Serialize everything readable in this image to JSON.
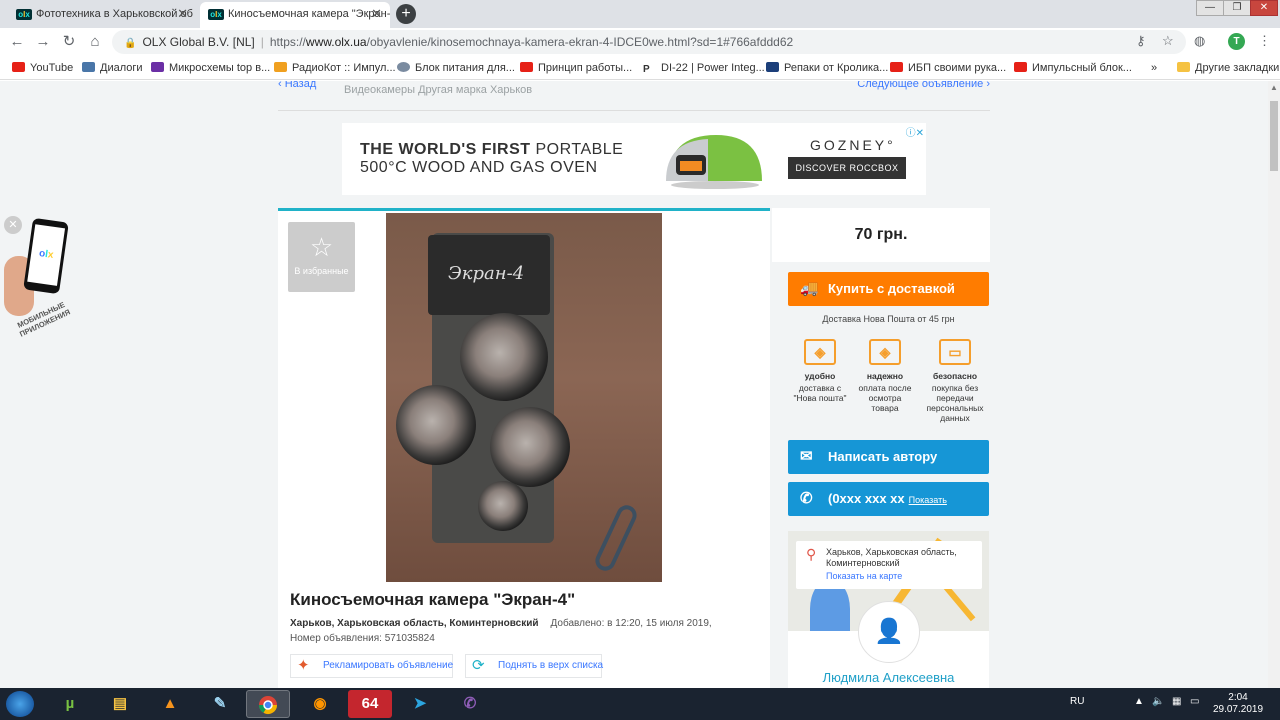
{
  "browser": {
    "tabs": [
      {
        "title": "Фототехника в Харьковской об",
        "close": "✕"
      },
      {
        "title": "Киносъемочная камера \"Экран-",
        "close": "✕"
      }
    ],
    "new_tab": "+",
    "window_controls": {
      "minimize": "—",
      "maximize": "❐",
      "close": "✕"
    },
    "address": {
      "org": "OLX Global B.V. [NL]",
      "url_prefix": "https://",
      "url_host": "www.olx.ua",
      "url_path": "/obyavlenie/kinosemochnaya-kamera-ekran-4-IDCE0we.html?sd=1#766afddd62"
    },
    "profile_initial": "T",
    "bookmarks": [
      {
        "label": "YouTube",
        "icon": "youtube-icon"
      },
      {
        "label": "Диалоги",
        "icon": "vk-icon"
      },
      {
        "label": "Микросхемы top в...",
        "icon": "bookmark-icon"
      },
      {
        "label": "РадиоКот :: Импул...",
        "icon": "radiokot-icon"
      },
      {
        "label": "Блок питания для...",
        "icon": "globe-icon"
      },
      {
        "label": "Принцип работы...",
        "icon": "youtube-icon"
      },
      {
        "label": "DI-22 | Power Integ...",
        "icon": "p-icon"
      },
      {
        "label": "Репаки от Кролика...",
        "icon": "re-icon"
      },
      {
        "label": "ИБП своими рука...",
        "icon": "youtube-icon"
      },
      {
        "label": "Импульсный блок...",
        "icon": "youtube-icon"
      }
    ],
    "bookmarks_overflow": "»",
    "other_bookmarks": "Другие закладки"
  },
  "breadcrumb": {
    "back": "Назад",
    "path": "Видеокамеры Другая марка Харьков",
    "next": "Следующее объявление"
  },
  "ad": {
    "line1_bold": "THE WORLD'S FIRST",
    "line1_light": "PORTABLE",
    "line2": "500°C WOOD AND GAS OVEN",
    "brand": "GOZNEY°",
    "cta": "DISCOVER ROCCBOX"
  },
  "listing": {
    "favorite_label": "В избранные",
    "camera_plate": "Экран-4",
    "title": "Киносъемочная камера \"Экран-4\"",
    "location": "Харьков, Харьковская область, Коминтерновский",
    "added": "Добавлено: в 12:20, 15 июля 2019,",
    "ad_number": "Номер объявления: 571035824",
    "promote": "Рекламировать объявление",
    "raise": "Поднять в верх списка"
  },
  "sidebar": {
    "price": "70 грн.",
    "buy_button": "Купить с доставкой",
    "delivery_note": "Доставка Нова Пошта от 45 грн",
    "benefits": [
      {
        "title": "удобно",
        "text": "доставка с \"Нова пошта\""
      },
      {
        "title": "надежно",
        "text": "оплата после осмотра товара"
      },
      {
        "title": "безопасно",
        "text": "покупка без передачи персональных данных"
      }
    ],
    "message_button": "Написать автору",
    "phone": "(0xxx xxx xx",
    "phone_show": "Показать",
    "map_address": "Харьков, Харьковская область, Коминтерновский",
    "map_show": "Показать на карте",
    "seller_name": "Людмила Алексеевна"
  },
  "app_promo": {
    "caption": "МОБИЛЬНЫЕ ПРИЛОЖЕНИЯ",
    "close": "✕"
  },
  "taskbar": {
    "apps": [
      "utorrent",
      "explorer",
      "avast",
      "paint",
      "chrome",
      "firefox",
      "64",
      "telegram",
      "viber"
    ],
    "app_64_label": "64",
    "language": "RU",
    "time": "2:04",
    "date": "29.07.2019"
  }
}
